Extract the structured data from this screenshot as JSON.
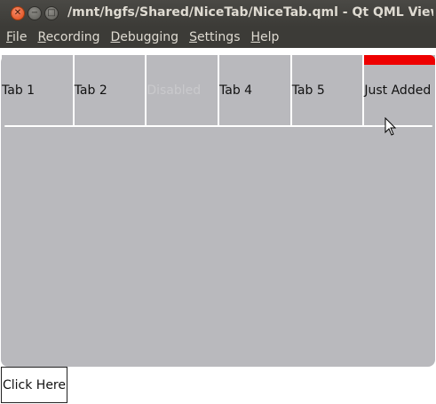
{
  "window": {
    "title": "/mnt/hgfs/Shared/NiceTab/NiceTab.qml - Qt QML Viewer",
    "buttons": [
      "close-icon",
      "minimize-icon",
      "maximize-icon"
    ]
  },
  "menubar": {
    "items": [
      {
        "mnemonic": "F",
        "rest": "ile"
      },
      {
        "mnemonic": "R",
        "rest": "ecording"
      },
      {
        "mnemonic": "D",
        "rest": "ebugging"
      },
      {
        "mnemonic": "S",
        "rest": "ettings"
      },
      {
        "mnemonic": "H",
        "rest": "elp"
      }
    ]
  },
  "tabs": [
    {
      "label": "Tab 1",
      "enabled": true,
      "active": false
    },
    {
      "label": "Tab 2",
      "enabled": true,
      "active": false
    },
    {
      "label": "Disabled",
      "enabled": false,
      "active": false
    },
    {
      "label": "Tab 4",
      "enabled": true,
      "active": false
    },
    {
      "label": "Tab 5",
      "enabled": true,
      "active": false
    },
    {
      "label": "Just Added",
      "enabled": true,
      "active": true
    }
  ],
  "colors": {
    "panel": "#b9b9bd",
    "active_indicator": "#ee0000",
    "titlebar": "#3c3b37",
    "disabled_text": "#c9c9cc"
  },
  "button": {
    "label": "Click Here"
  }
}
